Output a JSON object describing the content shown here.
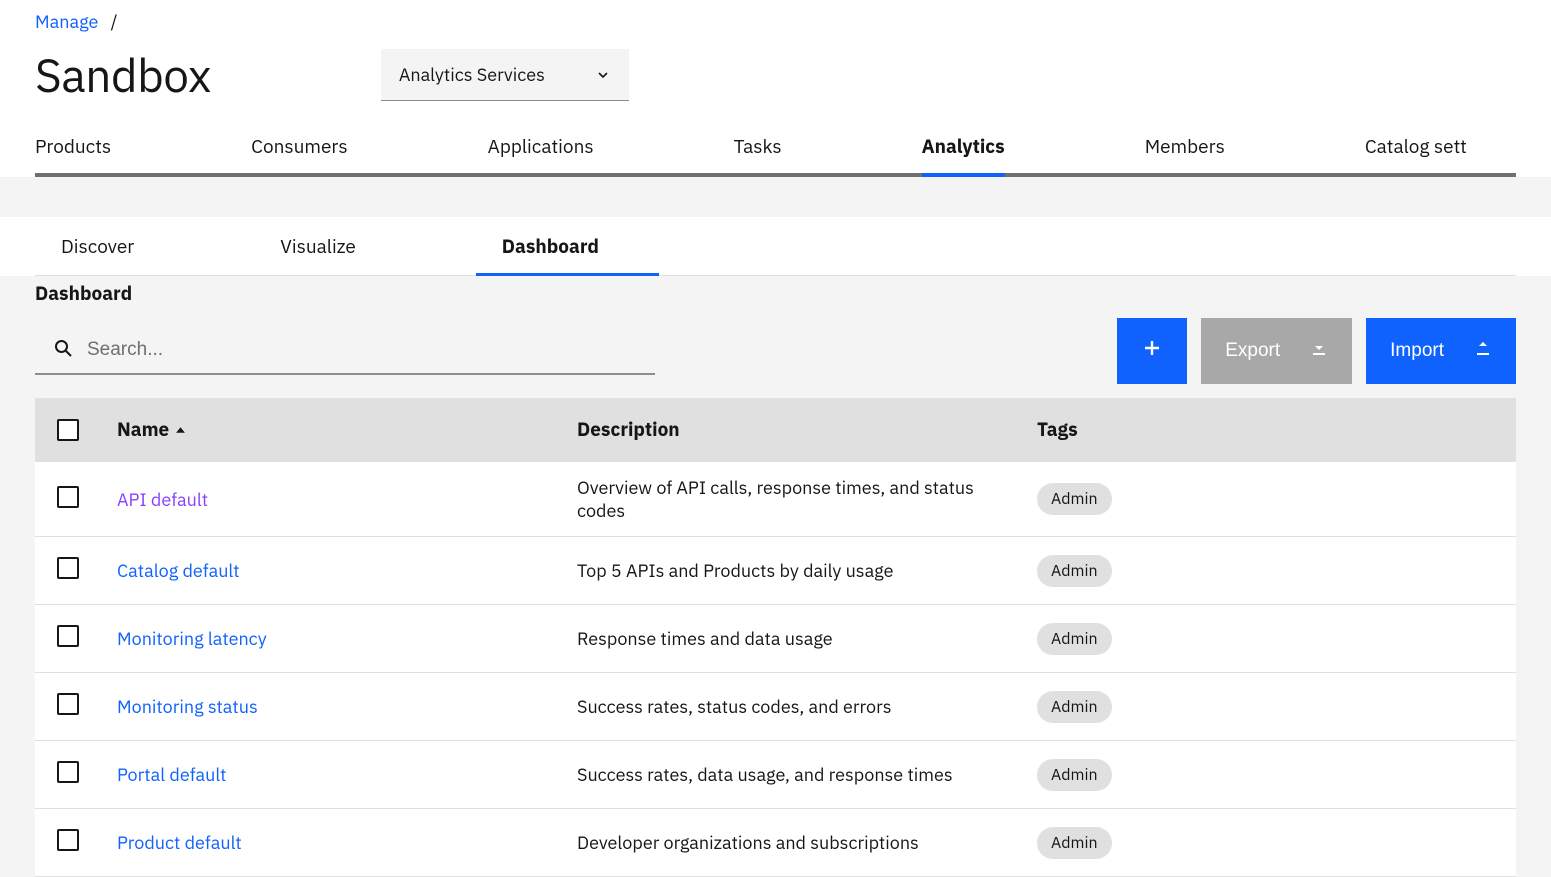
{
  "breadcrumb": {
    "parent": "Manage",
    "separator": "/"
  },
  "page_title": "Sandbox",
  "service_dropdown": {
    "selected": "Analytics Services"
  },
  "primary_tabs": [
    {
      "label": "Products",
      "active": false
    },
    {
      "label": "Consumers",
      "active": false
    },
    {
      "label": "Applications",
      "active": false
    },
    {
      "label": "Tasks",
      "active": false
    },
    {
      "label": "Analytics",
      "active": true
    },
    {
      "label": "Members",
      "active": false
    },
    {
      "label": "Catalog sett",
      "active": false
    }
  ],
  "secondary_tabs": [
    {
      "label": "Discover",
      "active": false
    },
    {
      "label": "Visualize",
      "active": false
    },
    {
      "label": "Dashboard",
      "active": true
    }
  ],
  "section_heading": "Dashboard",
  "search": {
    "placeholder": "Search..."
  },
  "buttons": {
    "export": "Export",
    "import": "Import"
  },
  "columns": {
    "name": "Name",
    "description": "Description",
    "tags": "Tags"
  },
  "rows": [
    {
      "name": "API default",
      "description": "Overview of API calls, response times, and status codes",
      "tag": "Admin",
      "visited": true
    },
    {
      "name": "Catalog default",
      "description": "Top 5 APIs and Products by daily usage",
      "tag": "Admin",
      "visited": false
    },
    {
      "name": "Monitoring latency",
      "description": "Response times and data usage",
      "tag": "Admin",
      "visited": false
    },
    {
      "name": "Monitoring status",
      "description": "Success rates, status codes, and errors",
      "tag": "Admin",
      "visited": false
    },
    {
      "name": "Portal default",
      "description": "Success rates, data usage, and response times",
      "tag": "Admin",
      "visited": false
    },
    {
      "name": "Product default",
      "description": "Developer organizations and subscriptions",
      "tag": "Admin",
      "visited": false
    }
  ]
}
